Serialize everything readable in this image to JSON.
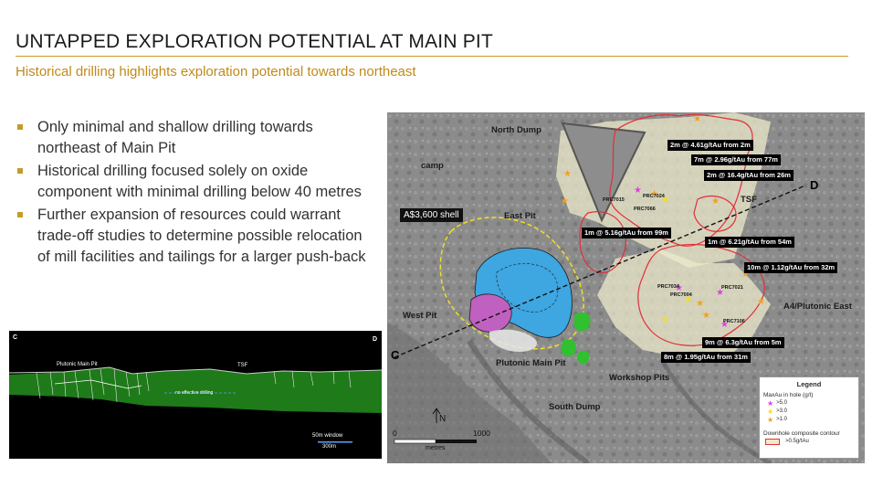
{
  "header": {
    "title": "UNTAPPED EXPLORATION POTENTIAL AT MAIN PIT",
    "subtitle": "Historical drilling highlights exploration potential towards northeast"
  },
  "bullets": [
    "Only minimal and shallow drilling towards northeast of Main Pit",
    "Historical drilling focused solely on oxide component with minimal drilling below 40 metres",
    "Further expansion of resources could warrant trade-off studies to determine possible relocation of mill facilities and tailings for a larger push-back"
  ],
  "section": {
    "end_c": "C",
    "end_d": "D",
    "pit_label": "Plutonic Main Pit",
    "tsf_label": "TSF",
    "no_drilling": "no effective drilling",
    "window": "50m window",
    "scale": "300m"
  },
  "map": {
    "places": {
      "north_dump": "North Dump",
      "camp": "camp",
      "east_pit": "East Pit",
      "tsf": "TSF",
      "west_pit": "West Pit",
      "a4": "A4/Plutonic East",
      "main_pit": "Plutonic Main Pit",
      "workshop": "Workshop Pits",
      "south_dump": "South Dump"
    },
    "shell": "A$3,600 shell",
    "section_c": "C",
    "section_d": "D",
    "north": "N",
    "scale_zero": "0",
    "scale_max": "1000",
    "scale_unit": "metres",
    "intercepts": [
      "2m @ 4.61g/tAu from 2m",
      "7m @ 2.96g/tAu from 77m",
      "2m @ 16.4g/tAu from 26m",
      "1m @ 5.16g/tAu from 99m",
      "1m @ 6.21g/tAu from 54m",
      "10m @ 1.12g/tAu from 32m",
      "9m @ 6.3g/tAu from 5m",
      "8m @ 1.95g/tAu from 31m"
    ],
    "holes": [
      "PRC7015",
      "PRC7024",
      "PRC7066",
      "PRC7034",
      "PRC7004",
      "PRC7021",
      "PRC7106"
    ],
    "legend": {
      "title": "Legend",
      "maxau": "MaxAu in hole (g/t)",
      "r1": ">5.0",
      "r2": ">3.0",
      "r3": ">1.0",
      "contour": "Downhole composite contour",
      "contour_val": ">0.5g/tAu"
    },
    "colors": {
      "high": "#e040e0",
      "mid": "#f0e020",
      "low": "#f0a020",
      "contour": "#e0303a"
    }
  }
}
